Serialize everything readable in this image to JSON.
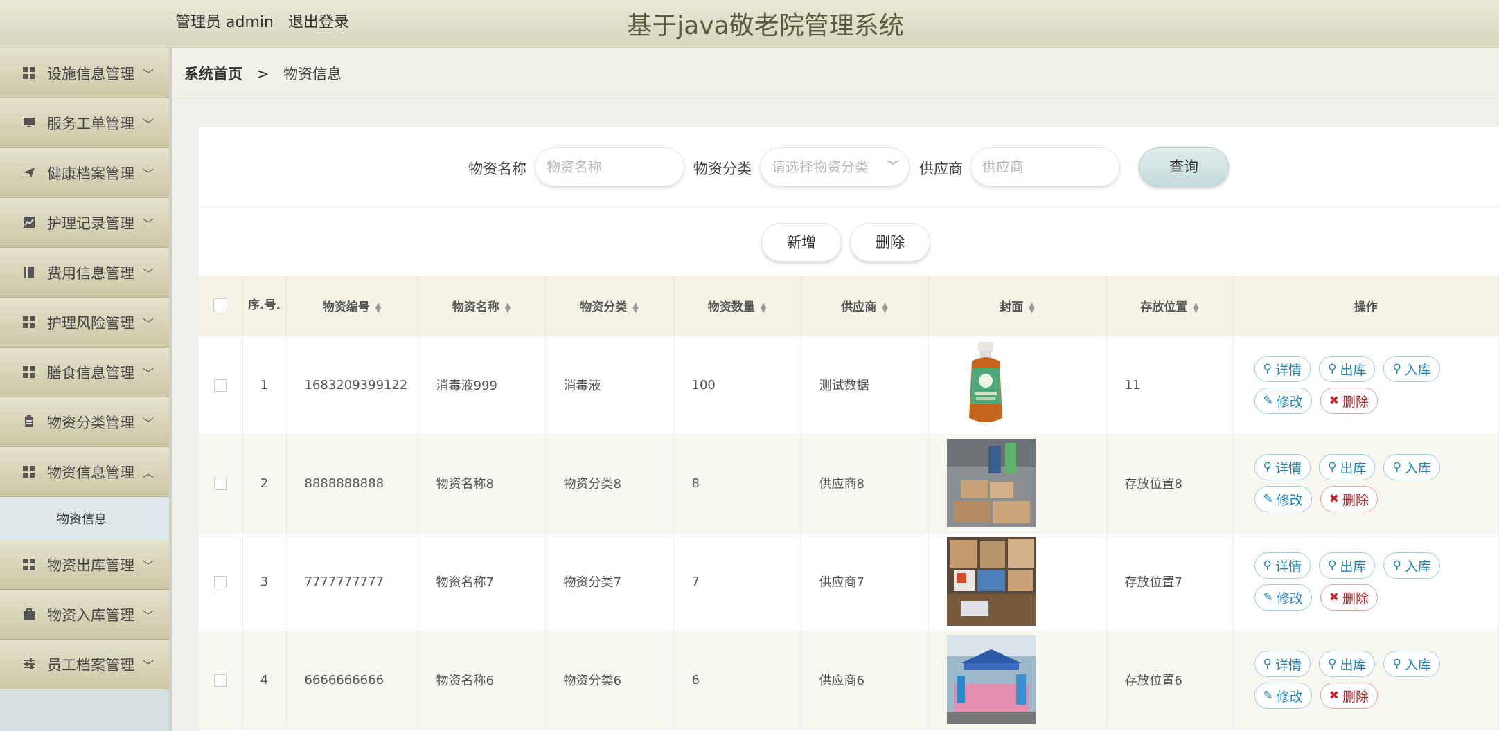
{
  "header": {
    "user_label": "管理员 admin",
    "logout_label": "退出登录",
    "title": "基于java敬老院管理系统"
  },
  "sidebar": {
    "items": [
      {
        "label": "设施信息管理",
        "icon": "grid-icon",
        "expanded": false
      },
      {
        "label": "服务工单管理",
        "icon": "monitor-icon",
        "expanded": false
      },
      {
        "label": "健康档案管理",
        "icon": "send-icon",
        "expanded": false
      },
      {
        "label": "护理记录管理",
        "icon": "chart-icon",
        "expanded": false
      },
      {
        "label": "费用信息管理",
        "icon": "book-icon",
        "expanded": false
      },
      {
        "label": "护理风险管理",
        "icon": "grid-icon",
        "expanded": false
      },
      {
        "label": "膳食信息管理",
        "icon": "grid-icon",
        "expanded": false
      },
      {
        "label": "物资分类管理",
        "icon": "clipboard-icon",
        "expanded": false
      },
      {
        "label": "物资信息管理",
        "icon": "grid-icon",
        "expanded": true
      },
      {
        "label": "物资出库管理",
        "icon": "grid-icon",
        "expanded": false
      },
      {
        "label": "物资入库管理",
        "icon": "briefcase-icon",
        "expanded": false
      },
      {
        "label": "员工档案管理",
        "icon": "sliders-icon",
        "expanded": false
      }
    ],
    "submenu_label": "物资信息"
  },
  "breadcrumb": {
    "home": "系统首页",
    "separator": ">",
    "current": "物资信息"
  },
  "search": {
    "name_label": "物资名称",
    "name_placeholder": "物资名称",
    "category_label": "物资分类",
    "category_placeholder": "请选择物资分类",
    "supplier_label": "供应商",
    "supplier_placeholder": "供应商",
    "query_button": "查询"
  },
  "actions": {
    "add": "新增",
    "delete": "删除"
  },
  "table": {
    "headers": [
      "序.号.",
      "物资编号",
      "物资名称",
      "物资分类",
      "物资数量",
      "供应商",
      "封面",
      "存放位置",
      "操作"
    ],
    "rows": [
      {
        "index": "1",
        "code": "1683209399122",
        "name": "消毒液999",
        "category": "消毒液",
        "qty": "100",
        "supplier": "测试数据",
        "location": "11",
        "cover": "disinfectant-bottle"
      },
      {
        "index": "2",
        "code": "8888888888",
        "name": "物资名称8",
        "category": "物资分类8",
        "qty": "8",
        "supplier": "供应商8",
        "location": "存放位置8",
        "cover": "boxes-street"
      },
      {
        "index": "3",
        "code": "7777777777",
        "name": "物资名称7",
        "category": "物资分类7",
        "qty": "7",
        "supplier": "供应商7",
        "location": "存放位置7",
        "cover": "boxes-shelf"
      },
      {
        "index": "4",
        "code": "6666666666",
        "name": "物资名称6",
        "category": "物资分类6",
        "qty": "6",
        "supplier": "供应商6",
        "location": "存放位置6",
        "cover": "tent-volunteers"
      }
    ],
    "ops": {
      "detail": "详情",
      "out": "出库",
      "in": "入库",
      "edit": "修改",
      "remove": "删除"
    }
  }
}
